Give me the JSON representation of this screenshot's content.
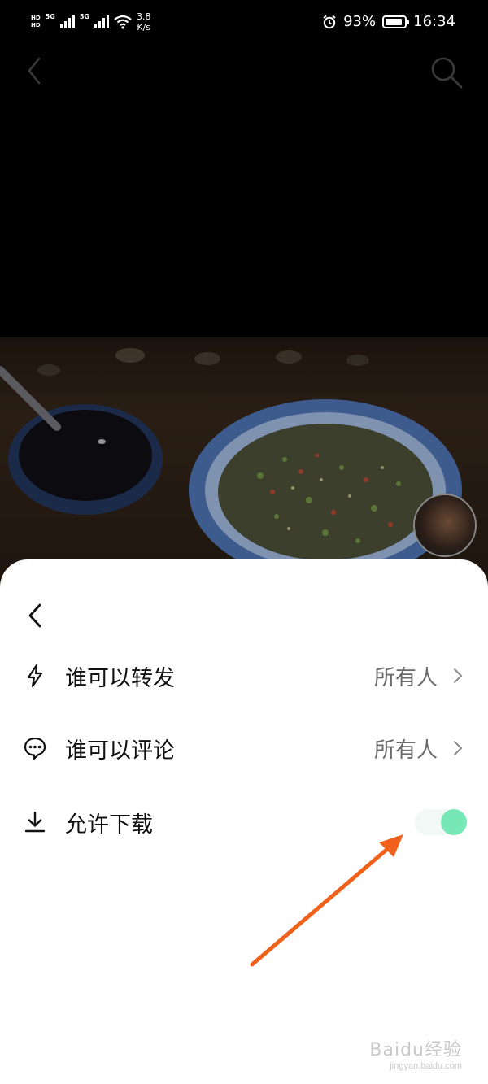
{
  "status_bar": {
    "network_hd_top": "HD",
    "network_hd_bottom": "HD",
    "network_type_1": "5G",
    "network_type_2": "5G",
    "speed_value": "3.8",
    "speed_unit": "K/s",
    "battery_percent": "93%",
    "time": "16:34",
    "battery_level": 0.93
  },
  "top_nav": {
    "back_icon": "chevron-left-icon",
    "search_icon": "search-icon"
  },
  "sheet": {
    "back_icon": "chevron-left-icon",
    "rows": [
      {
        "icon": "lightning-icon",
        "label": "谁可以转发",
        "value": "所有人"
      },
      {
        "icon": "comment-icon",
        "label": "谁可以评论",
        "value": "所有人"
      },
      {
        "icon": "download-icon",
        "label": "允许下载",
        "toggle_on": true
      }
    ]
  },
  "colors": {
    "toggle_on": "#77e8b5",
    "annotation_arrow": "#f0621b"
  },
  "watermark": {
    "main": "Baidu经验",
    "sub": "jingyan.baidu.com"
  }
}
